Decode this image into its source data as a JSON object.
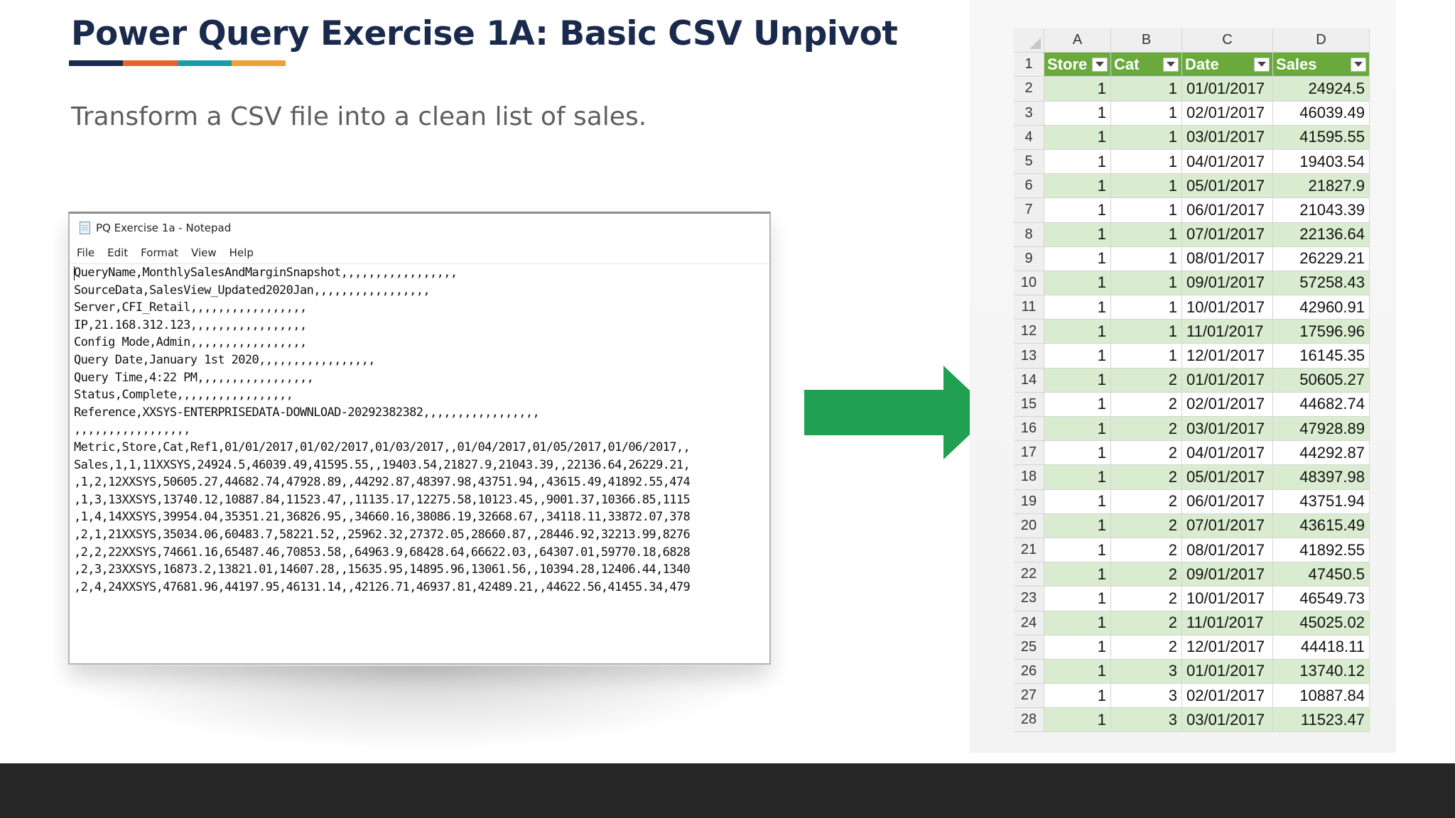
{
  "slide": {
    "title": "Power Query Exercise 1A: Basic CSV Unpivot",
    "subtitle": "Transform a CSV file into a clean list of sales.",
    "accent_colors": [
      "#1a2a4d",
      "#e8622a",
      "#1a9ba8",
      "#f0a030"
    ],
    "arrow_color": "#21a052",
    "footer_color": "#262626"
  },
  "notepad": {
    "window_title": "PQ Exercise 1a - Notepad",
    "menu": [
      "File",
      "Edit",
      "Format",
      "View",
      "Help"
    ],
    "lines": [
      "QueryName,MonthlySalesAndMarginSnapshot,,,,,,,,,,,,,,,,,",
      "SourceData,SalesView_Updated2020Jan,,,,,,,,,,,,,,,,,",
      "Server,CFI_Retail,,,,,,,,,,,,,,,,,",
      "IP,21.168.312.123,,,,,,,,,,,,,,,,,",
      "Config Mode,Admin,,,,,,,,,,,,,,,,,",
      "Query Date,January 1st 2020,,,,,,,,,,,,,,,,,",
      "Query Time,4:22 PM,,,,,,,,,,,,,,,,,",
      "Status,Complete,,,,,,,,,,,,,,,,,",
      "Reference,XXSYS-ENTERPRISEDATA-DOWNLOAD-20292382382,,,,,,,,,,,,,,,,,",
      ",,,,,,,,,,,,,,,,,",
      "Metric,Store,Cat,Ref1,01/01/2017,01/02/2017,01/03/2017,,01/04/2017,01/05/2017,01/06/2017,,",
      "Sales,1,1,11XXSYS,24924.5,46039.49,41595.55,,19403.54,21827.9,21043.39,,22136.64,26229.21,",
      ",1,2,12XXSYS,50605.27,44682.74,47928.89,,44292.87,48397.98,43751.94,,43615.49,41892.55,474",
      ",1,3,13XXSYS,13740.12,10887.84,11523.47,,11135.17,12275.58,10123.45,,9001.37,10366.85,1115",
      ",1,4,14XXSYS,39954.04,35351.21,36826.95,,34660.16,38086.19,32668.67,,34118.11,33872.07,378",
      ",2,1,21XXSYS,35034.06,60483.7,58221.52,,25962.32,27372.05,28660.87,,28446.92,32213.99,8276",
      ",2,2,22XXSYS,74661.16,65487.46,70853.58,,64963.9,68428.64,66622.03,,64307.01,59770.18,6828",
      ",2,3,23XXSYS,16873.2,13821.01,14607.28,,15635.95,14895.96,13061.56,,10394.28,12406.44,1340",
      ",2,4,24XXSYS,47681.96,44197.95,46131.14,,42126.71,46937.81,42489.21,,44622.56,41455.34,479"
    ]
  },
  "excel": {
    "column_letters": [
      "A",
      "B",
      "C",
      "D"
    ],
    "headers": [
      "Store",
      "Cat",
      "Date",
      "Sales"
    ],
    "header_fill": "#6aaa3c",
    "band_fill": "#d9ecd0",
    "rows": [
      {
        "n": "2",
        "store": "1",
        "cat": "1",
        "date": "01/01/2017",
        "sales": "24924.5"
      },
      {
        "n": "3",
        "store": "1",
        "cat": "1",
        "date": "02/01/2017",
        "sales": "46039.49"
      },
      {
        "n": "4",
        "store": "1",
        "cat": "1",
        "date": "03/01/2017",
        "sales": "41595.55"
      },
      {
        "n": "5",
        "store": "1",
        "cat": "1",
        "date": "04/01/2017",
        "sales": "19403.54"
      },
      {
        "n": "6",
        "store": "1",
        "cat": "1",
        "date": "05/01/2017",
        "sales": "21827.9"
      },
      {
        "n": "7",
        "store": "1",
        "cat": "1",
        "date": "06/01/2017",
        "sales": "21043.39"
      },
      {
        "n": "8",
        "store": "1",
        "cat": "1",
        "date": "07/01/2017",
        "sales": "22136.64"
      },
      {
        "n": "9",
        "store": "1",
        "cat": "1",
        "date": "08/01/2017",
        "sales": "26229.21"
      },
      {
        "n": "10",
        "store": "1",
        "cat": "1",
        "date": "09/01/2017",
        "sales": "57258.43"
      },
      {
        "n": "11",
        "store": "1",
        "cat": "1",
        "date": "10/01/2017",
        "sales": "42960.91"
      },
      {
        "n": "12",
        "store": "1",
        "cat": "1",
        "date": "11/01/2017",
        "sales": "17596.96"
      },
      {
        "n": "13",
        "store": "1",
        "cat": "1",
        "date": "12/01/2017",
        "sales": "16145.35"
      },
      {
        "n": "14",
        "store": "1",
        "cat": "2",
        "date": "01/01/2017",
        "sales": "50605.27"
      },
      {
        "n": "15",
        "store": "1",
        "cat": "2",
        "date": "02/01/2017",
        "sales": "44682.74"
      },
      {
        "n": "16",
        "store": "1",
        "cat": "2",
        "date": "03/01/2017",
        "sales": "47928.89"
      },
      {
        "n": "17",
        "store": "1",
        "cat": "2",
        "date": "04/01/2017",
        "sales": "44292.87"
      },
      {
        "n": "18",
        "store": "1",
        "cat": "2",
        "date": "05/01/2017",
        "sales": "48397.98"
      },
      {
        "n": "19",
        "store": "1",
        "cat": "2",
        "date": "06/01/2017",
        "sales": "43751.94"
      },
      {
        "n": "20",
        "store": "1",
        "cat": "2",
        "date": "07/01/2017",
        "sales": "43615.49"
      },
      {
        "n": "21",
        "store": "1",
        "cat": "2",
        "date": "08/01/2017",
        "sales": "41892.55"
      },
      {
        "n": "22",
        "store": "1",
        "cat": "2",
        "date": "09/01/2017",
        "sales": "47450.5"
      },
      {
        "n": "23",
        "store": "1",
        "cat": "2",
        "date": "10/01/2017",
        "sales": "46549.73"
      },
      {
        "n": "24",
        "store": "1",
        "cat": "2",
        "date": "11/01/2017",
        "sales": "45025.02"
      },
      {
        "n": "25",
        "store": "1",
        "cat": "2",
        "date": "12/01/2017",
        "sales": "44418.11"
      },
      {
        "n": "26",
        "store": "1",
        "cat": "3",
        "date": "01/01/2017",
        "sales": "13740.12"
      },
      {
        "n": "27",
        "store": "1",
        "cat": "3",
        "date": "02/01/2017",
        "sales": "10887.84"
      },
      {
        "n": "28",
        "store": "1",
        "cat": "3",
        "date": "03/01/2017",
        "sales": "11523.47"
      }
    ]
  }
}
